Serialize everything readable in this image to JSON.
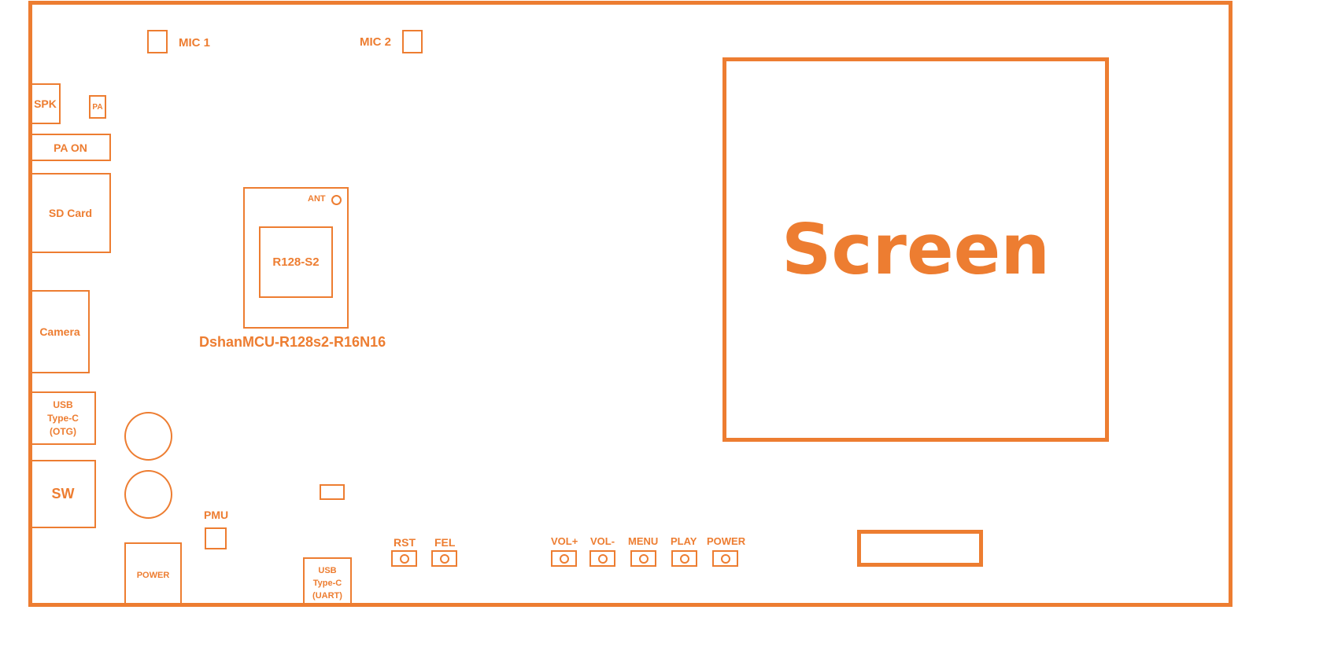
{
  "accent_color": "#ED7D31",
  "labels": {
    "mic1": "MIC 1",
    "mic2": "MIC 2",
    "spk": "SPK",
    "pa": "PA",
    "pa_on": "PA ON",
    "sd_card": "SD Card",
    "camera": "Camera",
    "usb_otg": [
      "USB",
      "Type-C",
      "(OTG)"
    ],
    "sw": "SW",
    "power_connector": "POWER",
    "pmu": "PMU",
    "usb_uart": [
      "USB",
      "Type-C",
      "(UART)"
    ],
    "ant": "ANT",
    "chip": "R128-S2",
    "module_name": "DshanMCU-R128s2-R16N16",
    "screen": "Screen"
  },
  "buttons": {
    "rst": "RST",
    "fel": "FEL",
    "vol_up": "VOL+",
    "vol_down": "VOL-",
    "menu": "MENU",
    "play": "PLAY",
    "power": "POWER"
  }
}
